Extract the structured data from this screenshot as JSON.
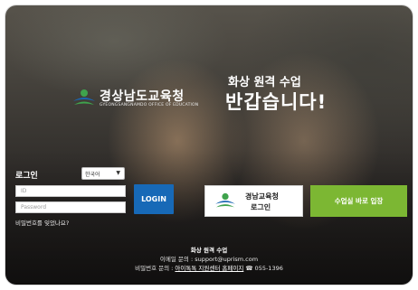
{
  "brand": {
    "logo_name": "경상남도교육청",
    "logo_subtitle": "GYEONGSANGNAMDO OFFICE OF EDUCATION"
  },
  "hero": {
    "title_small": "화상 원격 수업",
    "title_big": "반갑습니다!"
  },
  "login": {
    "label": "로그인",
    "language_selected": "한국어",
    "id_placeholder": "ID",
    "password_placeholder": "Password",
    "forgot_password": "비밀번호를 잊었나요?",
    "login_button": "LOGIN"
  },
  "buttons": {
    "edu_login_line1": "경남교육청",
    "edu_login_line2": "로그인",
    "enter_class": "수업실 바로 입장"
  },
  "footer": {
    "service_name": "화상 원격 수업",
    "email_line": "이메일 문의 : support@uprism.com",
    "password_prefix": "비밀번호 문의 :",
    "password_link": "아이톡톡 지원센터 홈페이지",
    "phone": "☎ 055-1396"
  },
  "colors": {
    "login_button": "#1769b7",
    "enter_button": "#7cb733",
    "logo_blue": "#1a66b3",
    "logo_green": "#3fa34d"
  },
  "icons": {
    "logo": "gyeongnam-edu-logo-icon",
    "select_arrow": "chevron-down-icon"
  }
}
